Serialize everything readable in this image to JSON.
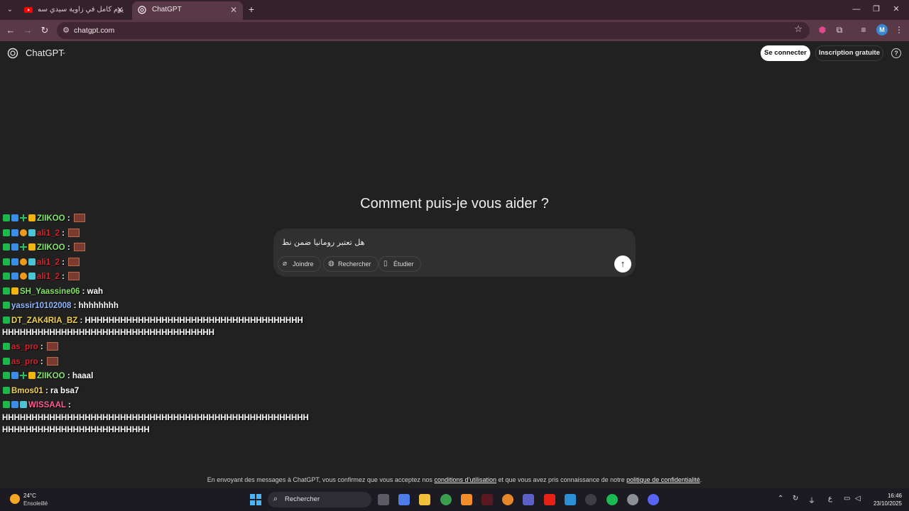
{
  "browser": {
    "tabs": [
      {
        "title": "يوم كامل في زاوية سيدي سماعين",
        "active": false
      },
      {
        "title": "ChatGPT",
        "active": true
      }
    ],
    "url": "chatgpt.com",
    "profile_initial": "M"
  },
  "app": {
    "brand": "ChatGPT",
    "login_label": "Se connecter",
    "signup_label": "Inscription gratuite",
    "heading": "Comment puis-je vous aider ?",
    "composer": {
      "input_value": "هل تعتبر رومانيا ضمن نط",
      "attach_label": "Joindre",
      "search_label": "Rechercher",
      "study_label": "Étudier"
    },
    "footer": {
      "prefix": "En envoyant des messages à ChatGPT, vous confirmez que vous acceptez nos",
      "terms": "conditions d’utilisation",
      "middle": "et que vous avez pris connaissance de notre",
      "privacy": "politique de confidentialité",
      "suffix": "."
    }
  },
  "stream_chat": [
    {
      "user": "ZIIKOO",
      "message": "",
      "color": "green",
      "badges": [
        "k",
        "a",
        "s",
        "c"
      ],
      "emote": true
    },
    {
      "user": "ali1_2",
      "message": "",
      "color": "red",
      "badges": [
        "k",
        "a",
        "o",
        "g"
      ],
      "emote": true
    },
    {
      "user": "ZIIKOO",
      "message": "",
      "color": "green",
      "badges": [
        "k",
        "a",
        "s",
        "c"
      ],
      "emote": true
    },
    {
      "user": "ali1_2",
      "message": "",
      "color": "red",
      "badges": [
        "k",
        "a",
        "o",
        "g"
      ],
      "emote": true
    },
    {
      "user": "ali1_2",
      "message": "",
      "color": "red",
      "badges": [
        "k",
        "a",
        "o",
        "g"
      ],
      "emote": true
    },
    {
      "user": "SH_Yaassine06",
      "message": "wah",
      "color": "green",
      "badges": [
        "k",
        "c"
      ],
      "emote": false
    },
    {
      "user": "yassir10102008",
      "message": "hhhhhhhh",
      "color": "blue",
      "badges": [
        "k"
      ],
      "emote": false
    },
    {
      "user": "DT_ZAK4RIA_BZ",
      "message": "HHHHHHHHHHHHHHHHHHHHHHHHHHHHHHHHHHHHH",
      "continuation": "HHHHHHHHHHHHHHHHHHHHHHHHHHHHHHHHHHHH",
      "color": "yellow",
      "badges": [
        "k"
      ],
      "emote": false
    },
    {
      "user": "as_pro",
      "message": "",
      "color": "red",
      "badges": [
        "k"
      ],
      "emote": true
    },
    {
      "user": "as_pro",
      "message": "",
      "color": "red",
      "badges": [
        "k"
      ],
      "emote": true
    },
    {
      "user": "ZIIKOO",
      "message": "haaal",
      "color": "green",
      "badges": [
        "k",
        "a",
        "s",
        "c"
      ],
      "emote": false
    },
    {
      "user": "Bmos01",
      "message": "ra bsa7",
      "color": "yellow",
      "badges": [
        "k"
      ],
      "emote": false
    },
    {
      "user": "WISSAAL",
      "message": "",
      "continuation": "HHHHHHHHHHHHHHHHHHHHHHHHHHHHHHHHHHHHHHHHHHHHHHHHHHHH",
      "continuation2": "HHHHHHHHHHHHHHHHHHHHHHHHH",
      "color": "pink",
      "badges": [
        "k",
        "a",
        "g"
      ],
      "emote": false
    }
  ],
  "taskbar": {
    "temperature": "24°C",
    "condition": "Ensoleillé",
    "search_label": "Rechercher",
    "lang": "ع",
    "time": "16:46",
    "date": "23/10/2025"
  }
}
